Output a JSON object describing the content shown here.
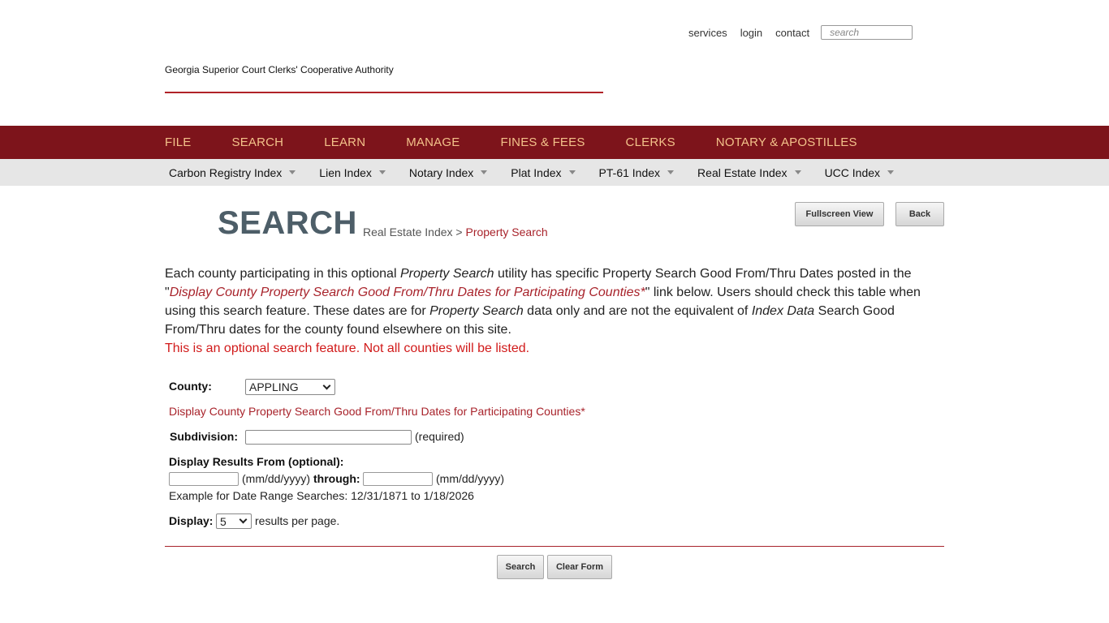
{
  "top": {
    "links": [
      "services",
      "login",
      "contact"
    ],
    "search_placeholder": "search"
  },
  "header": {
    "org_name": "Georgia Superior Court Clerks' Cooperative Authority"
  },
  "primary_nav": [
    "FILE",
    "SEARCH",
    "LEARN",
    "MANAGE",
    "FINES & FEES",
    "CLERKS",
    "NOTARY & APOSTILLES"
  ],
  "secondary_nav": [
    "Carbon Registry Index",
    "Lien Index",
    "Notary Index",
    "Plat Index",
    "PT-61 Index",
    "Real Estate Index",
    "UCC Index"
  ],
  "page": {
    "title": "SEARCH",
    "breadcrumb_parent": "Real Estate Index",
    "breadcrumb_sep": ">",
    "breadcrumb_current": "Property Search",
    "fullscreen_label": "Fullscreen View",
    "back_label": "Back"
  },
  "intro": {
    "p1": "Each county participating in this optional ",
    "p1_em": "Property Search",
    "p2": " utility has specific Property Search Good From/Thru Dates posted in the \"",
    "link": "Display County Property Search Good From/Thru Dates for Participating Counties*",
    "p3": "\" link below. Users should check this table when using this search feature. These dates are for ",
    "p3_em": "Property Search",
    "p4": " data only and are not the equivalent of ",
    "p4_em": "Index Data",
    "p5": " Search Good From/Thru dates for the county found elsewhere on this site.",
    "notice": "This is an optional search feature. Not all counties will be listed."
  },
  "form": {
    "county_label": "County:",
    "county_value": "APPLING",
    "county_link": "Display County Property Search Good From/Thru Dates for Participating Counties*",
    "subdivision_label": "Subdivision:",
    "subdivision_value": "",
    "required_text": "(required)",
    "date_label": "Display Results From (optional):",
    "date_format_1": "(mm/dd/yyyy)",
    "through_label": "through:",
    "date_format_2": "(mm/dd/yyyy)",
    "example_text": "Example for Date Range Searches: 12/31/1871 to 1/18/2026",
    "display_label": "Display:",
    "display_value": "5",
    "results_per_page": "results per page.",
    "search_label": "Search",
    "clear_label": "Clear Form"
  }
}
